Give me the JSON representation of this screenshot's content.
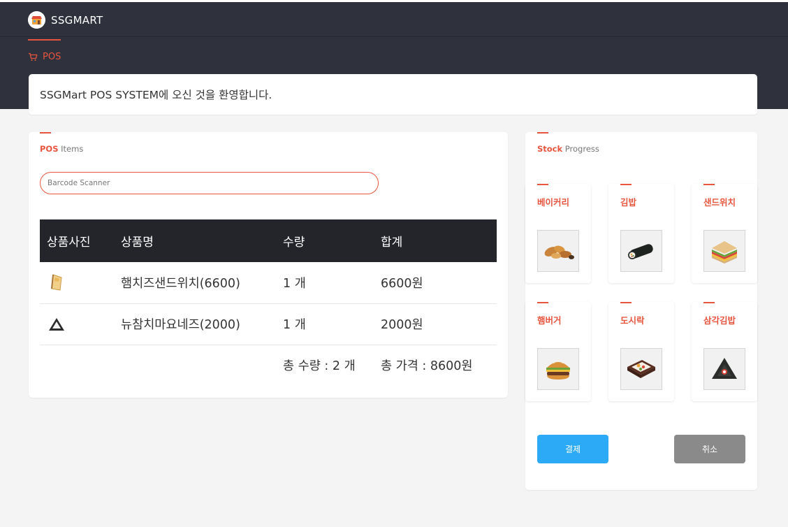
{
  "app": {
    "brand": "SSGMART",
    "nav_tab": "POS"
  },
  "welcome": {
    "message": "SSGMart POS SYSTEM에 오신 것을 환영합니다."
  },
  "pos": {
    "title_bold": "POS",
    "title_rest": " Items",
    "barcode": {
      "placeholder": "Barcode Scanner",
      "value": ""
    },
    "columns": [
      "상품사진",
      "상품명",
      "수량",
      "합계"
    ],
    "rows": [
      {
        "image": "sandwich-slice-icon",
        "name": "햄치즈샌드위치(6600)",
        "qty": "1 개",
        "sum": "6600원"
      },
      {
        "image": "triangle-kimbap-icon",
        "name": "뉴참치마요네즈(2000)",
        "qty": "1 개",
        "sum": "2000원"
      }
    ],
    "total_qty": "총 수량 : 2 개",
    "total_price": "총 가격 : 8600원"
  },
  "stock": {
    "title_bold": "Stock",
    "title_rest": " Progress",
    "items": [
      {
        "name": "베이커리",
        "icon": "bakery-icon"
      },
      {
        "name": "김밥",
        "icon": "kimbap-icon"
      },
      {
        "name": "샌드위치",
        "icon": "sandwich-icon"
      },
      {
        "name": "햄버거",
        "icon": "hamburger-icon"
      },
      {
        "name": "도시락",
        "icon": "lunchbox-icon"
      },
      {
        "name": "삼각김밥",
        "icon": "triangle-kimbap-icon"
      }
    ],
    "pay_label": "결제",
    "cancel_label": "취소"
  },
  "colors": {
    "accent": "#e8553e",
    "header": "#2f323c",
    "pay": "#2daaf5",
    "cancel": "#8a8a8a",
    "table_head": "#23252b"
  }
}
